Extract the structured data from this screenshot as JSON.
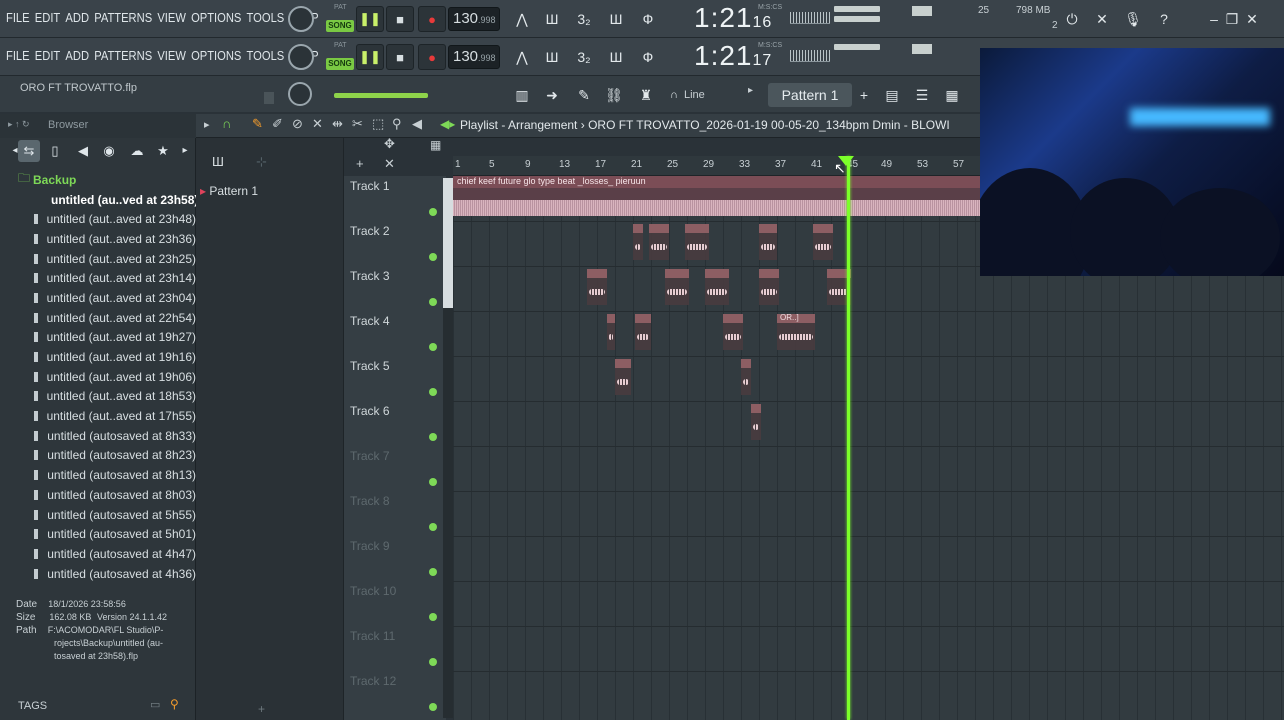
{
  "menu": {
    "items": [
      "FILE",
      "EDIT",
      "ADD",
      "PATTERNS",
      "VIEW",
      "OPTIONS",
      "TOOLS",
      "HELP"
    ]
  },
  "transport_row1": {
    "pat": "PAT",
    "song": "SONG",
    "tempo": "130",
    "tempo_dec": ".998",
    "time_main": "1:21",
    "time_sub": "16",
    "mcs": "M:S:CS",
    "cpu": "25",
    "memory": "798 MB",
    "voices": "2"
  },
  "transport_row2": {
    "pat": "PAT",
    "song": "SONG",
    "tempo": "130",
    "tempo_dec": ".998",
    "time_main": "1:21",
    "time_sub": "17",
    "mcs": "M:S:CS",
    "cpu": "25",
    "memory": "798 MB"
  },
  "project": {
    "filename": "ORO FT TROVATTO.flp",
    "snap": "Line",
    "pattern": "Pattern 1"
  },
  "browser": {
    "title": "Browser",
    "folder": "Backup",
    "files": [
      "untitled (au..ved at 23h58)",
      "untitled (aut..aved at 23h48)",
      "untitled (aut..aved at 23h36)",
      "untitled (aut..aved at 23h25)",
      "untitled (aut..aved at 23h14)",
      "untitled (aut..aved at 23h04)",
      "untitled (aut..aved at 22h54)",
      "untitled (aut..aved at 19h27)",
      "untitled (aut..aved at 19h16)",
      "untitled (aut..aved at 19h06)",
      "untitled (aut..aved at 18h53)",
      "untitled (aut..aved at 17h55)",
      "untitled (autosaved at 8h33)",
      "untitled (autosaved at 8h23)",
      "untitled (autosaved at 8h13)",
      "untitled (autosaved at 8h03)",
      "untitled (autosaved at 5h55)",
      "untitled (autosaved at 5h01)",
      "untitled (autosaved at 4h47)",
      "untitled (autosaved at 4h36)"
    ],
    "info": {
      "date_label": "Date",
      "date": "18/1/2026 23:58:56",
      "size_label": "Size",
      "size": "162.08 KB",
      "version": "Version 24.1.1.42",
      "path_label": "Path",
      "path1": "F:\\ACOMODAR\\FL Studio\\P-",
      "path2": "rojects\\Backup\\untitled (au-",
      "path3": "tosaved at 23h58).flp"
    },
    "tags": "TAGS"
  },
  "patterns_panel": {
    "item": "Pattern 1"
  },
  "playlist": {
    "title": "Playlist - Arrangement",
    "project_title": "ORO FT TROVATTO_2026-01-19 00-05-20_134bpm Dmin - BLOWI",
    "ruler": [
      "1",
      "5",
      "9",
      "13",
      "17",
      "21",
      "25",
      "29",
      "33",
      "37",
      "41",
      "45",
      "49",
      "53",
      "57"
    ],
    "tracks": [
      "Track 1",
      "Track 2",
      "Track 3",
      "Track 4",
      "Track 5",
      "Track 6",
      "Track 7",
      "Track 8",
      "Track 9",
      "Track 10",
      "Track 11",
      "Track 12"
    ],
    "main_clip": "chief keef future glo type beat _losses_ pieruun",
    "small_clip_label": "OR..]"
  },
  "colors": {
    "accent_green": "#7ed957",
    "playhead": "#7cff2a",
    "clip": "#8d5e63"
  }
}
